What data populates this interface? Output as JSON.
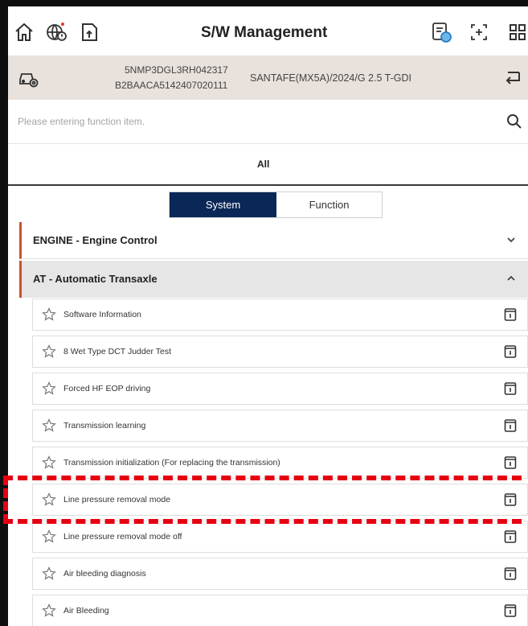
{
  "header": {
    "title": "S/W Management",
    "icons": [
      "home-icon",
      "globe-alert-icon",
      "document-upload-icon",
      "vehicle-report-icon",
      "scan-icon",
      "grid-menu-icon"
    ]
  },
  "vehicle": {
    "vin": "5NMP3DGL3RH042317",
    "ecu_id": "B2BAACA5142407020111",
    "model": "SANTAFE(MX5A)/2024/G 2.5 T-GDI"
  },
  "search": {
    "placeholder": "Please entering function item."
  },
  "tabs": {
    "all": "All"
  },
  "segmented": {
    "system": "System",
    "function": "Function",
    "selected": "System"
  },
  "groups": {
    "engine": "ENGINE - Engine Control",
    "at": "AT - Automatic Transaxle"
  },
  "items": [
    "Software Information",
    "8 Wet Type DCT Judder Test",
    "Forced HF EOP driving",
    "Transmission learning",
    "Transmission initialization (For replacing the transmission)",
    "Line pressure removal mode",
    "Line pressure removal mode off",
    "Air bleeding diagnosis",
    "Air Bleeding"
  ],
  "colors": {
    "accent_navy": "#0b2757",
    "group_marker": "#c9532e",
    "highlight": "#e60012",
    "vehicle_bar": "#e8e1dc"
  }
}
